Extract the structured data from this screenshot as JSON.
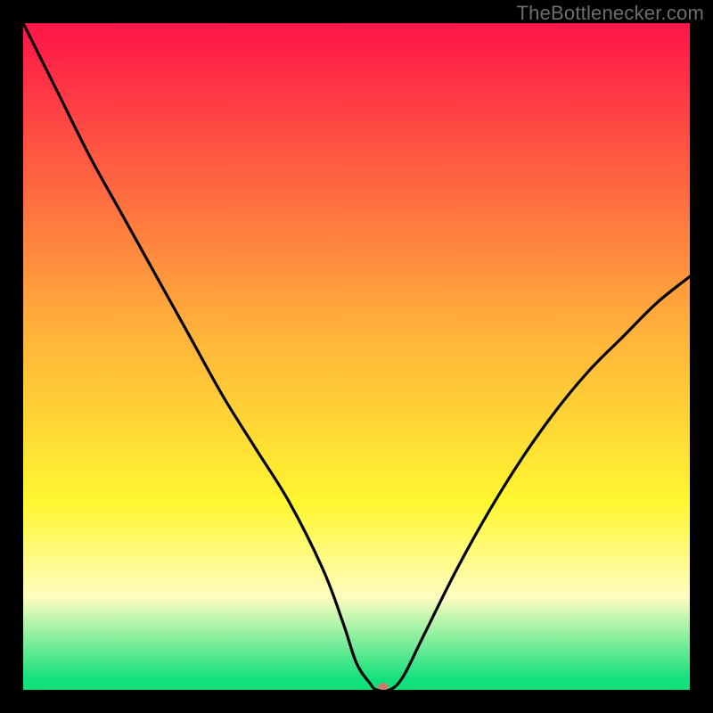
{
  "watermark": "TheBottlenecker.com",
  "colors": {
    "bg_frame": "#000000",
    "grad_red": "#ff1448",
    "grad_orange": "#ffae3b",
    "grad_yellow": "#fff730",
    "grad_pale": "#fffdc0",
    "grad_green": "#11e07b",
    "line": "#000000",
    "marker": "#cb7b6c"
  },
  "chart_data": {
    "type": "line",
    "title": "",
    "xlabel": "",
    "ylabel": "",
    "xlim": [
      0,
      100
    ],
    "ylim": [
      0,
      100
    ],
    "series": [
      {
        "name": "bottleneck-curve",
        "x": [
          0,
          5,
          10,
          15,
          20,
          25,
          30,
          35,
          40,
          45,
          48,
          50,
          52,
          53,
          55,
          57,
          60,
          65,
          70,
          75,
          80,
          85,
          90,
          95,
          100
        ],
        "y": [
          100,
          90,
          80,
          71,
          62,
          53,
          44,
          36,
          28,
          18,
          10,
          4,
          1,
          0,
          0,
          2,
          8,
          18,
          27,
          35,
          42,
          48,
          53,
          58,
          62
        ]
      }
    ],
    "marker": {
      "x": 54,
      "y": 0.5,
      "color": "#cb7b6c",
      "rx": 6,
      "ry": 4
    },
    "background_gradient_stops": [
      {
        "offset": 0.0,
        "color": "#ff1448"
      },
      {
        "offset": 0.45,
        "color": "#ffae3b"
      },
      {
        "offset": 0.72,
        "color": "#fff730"
      },
      {
        "offset": 0.86,
        "color": "#fffdc0"
      },
      {
        "offset": 0.985,
        "color": "#11e07b"
      }
    ]
  }
}
